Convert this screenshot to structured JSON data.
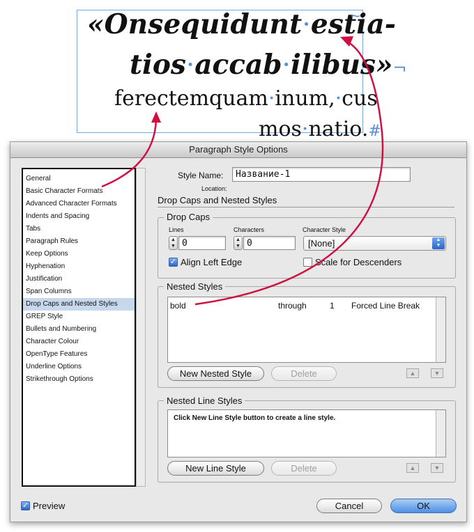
{
  "preview_text": {
    "line1": [
      "«Onsequidunt",
      "estia-"
    ],
    "line2": [
      "tios",
      "accab",
      "ilibus»"
    ],
    "line3": [
      "ferectemquam",
      "inum,",
      "cus"
    ],
    "line4": [
      "mos",
      "natio."
    ],
    "dot": "·",
    "end_mark": "#",
    "overflow_mark": "~",
    "nested_mark": "¬"
  },
  "dialog": {
    "title": "Paragraph Style Options",
    "categories": [
      "General",
      "Basic Character Formats",
      "Advanced Character Formats",
      "Indents and Spacing",
      "Tabs",
      "Paragraph Rules",
      "Keep Options",
      "Hyphenation",
      "Justification",
      "Span Columns",
      "Drop Caps and Nested Styles",
      "GREP Style",
      "Bullets and Numbering",
      "Character Colour",
      "OpenType Features",
      "Underline Options",
      "Strikethrough Options"
    ],
    "selected_category": "Drop Caps and Nested Styles",
    "style_name_label": "Style Name:",
    "style_name_value": "Название-1",
    "location_label": "Location:",
    "section_title": "Drop Caps and Nested Styles",
    "drop_caps": {
      "title": "Drop Caps",
      "lines_label": "Lines",
      "lines_value": "0",
      "characters_label": "Characters",
      "characters_value": "0",
      "character_style_label": "Character Style",
      "character_style_value": "[None]",
      "align_left_edge_label": "Align Left Edge",
      "align_left_edge_checked": true,
      "scale_descenders_label": "Scale for Descenders",
      "scale_descenders_checked": false
    },
    "nested_styles": {
      "title": "Nested Styles",
      "rows": [
        {
          "style": "bold",
          "mode": "through",
          "count": "1",
          "until": "Forced Line Break"
        }
      ],
      "new_button": "New Nested Style",
      "delete_button": "Delete"
    },
    "nested_line_styles": {
      "title": "Nested Line Styles",
      "hint": "Click New Line Style button to create a line style.",
      "new_button": "New Line Style",
      "delete_button": "Delete"
    },
    "preview_label": "Preview",
    "preview_checked": true,
    "cancel_button": "Cancel",
    "ok_button": "OK"
  },
  "colors": {
    "annotation_arrow": "#d01040",
    "frame_border": "#7aa7dd",
    "selection": "#c8d8ec",
    "default_button": "#4d8fe3"
  }
}
